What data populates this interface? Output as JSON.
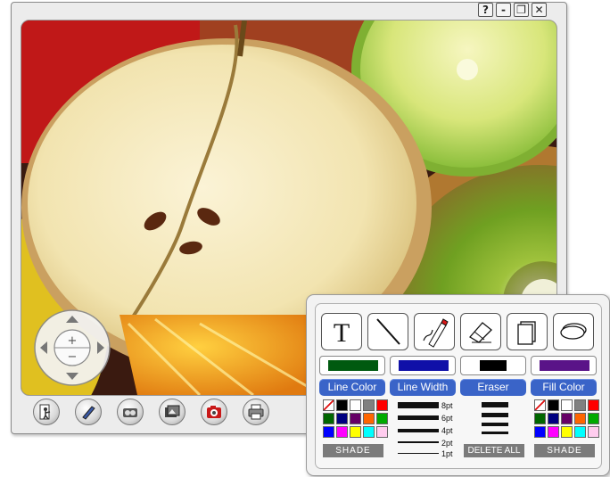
{
  "window": {
    "buttons": {
      "help": "?",
      "minimize": "-",
      "restore": "❐",
      "close": "✕"
    }
  },
  "navpad": {
    "zoom_in": "+",
    "zoom_out": "−"
  },
  "toolbar": {
    "icons": [
      "exit-icon",
      "pen-icon",
      "camera-icon",
      "photo-gallery-icon",
      "capture-icon",
      "print-icon"
    ]
  },
  "panel": {
    "tools": [
      "text-tool",
      "line-tool",
      "pencil-tool",
      "eraser-tool",
      "rectangle-tool",
      "ellipse-tool"
    ],
    "text_tool_glyph": "T",
    "selected": {
      "line_color": "#005a10",
      "line_width": "#1010a8",
      "eraser": "#000000",
      "fill_color": "#5a1488"
    },
    "headers": {
      "line_color": "Line Color",
      "line_width": "Line Width",
      "eraser": "Eraser",
      "fill_color": "Fill Color"
    },
    "palette": [
      "none",
      "#000000",
      "#ffffff",
      "#808080",
      "#ff0000",
      "#006600",
      "#000080",
      "#660066",
      "#ff6600",
      "#00aa00",
      "#0000ff",
      "#ff00ff",
      "#ffff00",
      "#00ffff",
      "#ffccee"
    ],
    "line_widths": [
      "8pt",
      "6pt",
      "4pt",
      "2pt",
      "1pt"
    ],
    "shade_label": "SHADE",
    "delete_all_label": "DELETE ALL"
  }
}
